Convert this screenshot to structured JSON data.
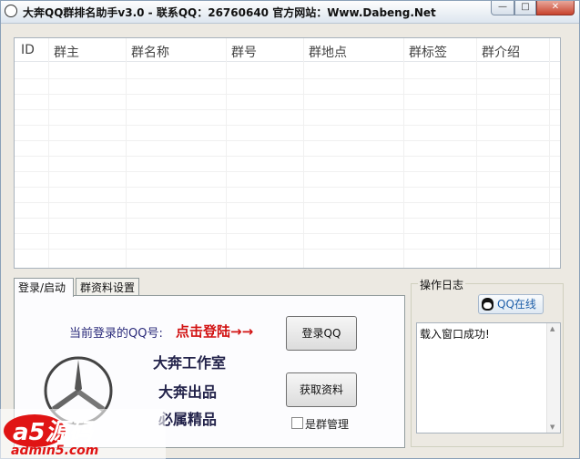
{
  "window": {
    "title": "大奔QQ群排名助手v3.0 - 联系QQ：26760640 官方网站：Www.Dabeng.Net",
    "min_glyph": "—",
    "max_glyph": "□",
    "close_glyph": "✕"
  },
  "group_list": {
    "columns": [
      "ID",
      "群主",
      "群名称",
      "群号",
      "群地点",
      "群标签",
      "群介绍"
    ],
    "rows": []
  },
  "tabs": [
    {
      "label": "登录/启动",
      "active": true
    },
    {
      "label": "群资料设置",
      "active": false
    }
  ],
  "login_panel": {
    "current_qq_label": "当前登录的QQ号:",
    "login_prompt": "点击登陆→→",
    "login_button": "登录QQ",
    "fetch_button": "获取资料",
    "studio_line1": "大奔工作室",
    "studio_line2": "大奔出品",
    "studio_line3": "必属精品",
    "group_admin_checkbox": "是群管理",
    "group_admin_checked": false
  },
  "log_panel": {
    "title": "操作日志",
    "qq_online_button": "QQ在线",
    "log_lines": [
      "载入窗口成功!"
    ]
  },
  "watermark": {
    "brand": "a5源码",
    "url": "admin5.com"
  },
  "colors": {
    "login_prompt": "#d21313",
    "studio_text": "#22224a",
    "watermark_red": "#e01414"
  }
}
